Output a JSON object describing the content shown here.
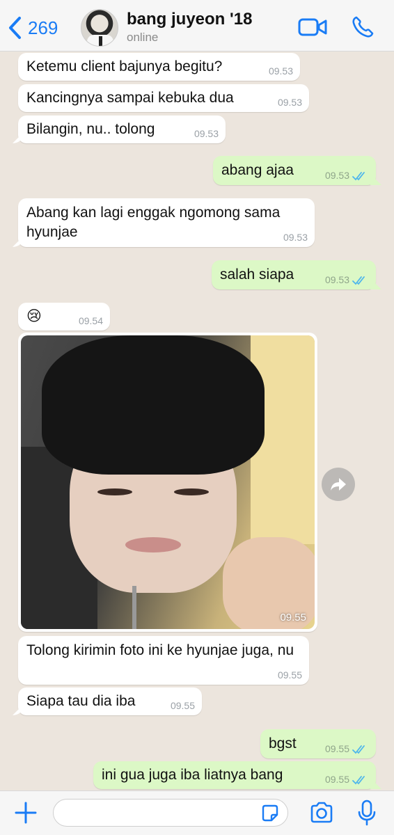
{
  "header": {
    "back_count": "269",
    "contact_name": "bang juyeon '18",
    "status": "online"
  },
  "messages": [
    {
      "dir": "in",
      "text": "Ketemu client bajunya begitu?",
      "time": "09.53"
    },
    {
      "dir": "in",
      "text": "Kancingnya sampai kebuka dua",
      "time": "09.53"
    },
    {
      "dir": "in",
      "text": "Bilangin, nu.. tolong",
      "time": "09.53"
    },
    {
      "dir": "out",
      "text": "abang ajaa",
      "time": "09.53"
    },
    {
      "dir": "in",
      "text": "Abang kan lagi enggak ngomong sama hyunjae",
      "time": "09.53"
    },
    {
      "dir": "out",
      "text": "salah siapa",
      "time": "09.53"
    },
    {
      "dir": "in",
      "text": "😢",
      "time": "09.54"
    },
    {
      "dir": "in",
      "type": "photo",
      "time": "09.55"
    },
    {
      "dir": "in",
      "text": "Tolong kirimin foto ini ke hyunjae juga, nu",
      "time": "09.55"
    },
    {
      "dir": "in",
      "text": "Siapa tau dia iba",
      "time": "09.55"
    },
    {
      "dir": "out",
      "text": "bgst",
      "time": "09.55"
    },
    {
      "dir": "out",
      "text": "ini gua juga iba liatnya bang",
      "time": "09.55"
    }
  ],
  "input": {
    "value": ""
  },
  "colors": {
    "accent": "#1a7cf5",
    "outgoing": "#dcf8c6",
    "incoming": "#ffffff",
    "background": "#ece5dd",
    "read_ticks": "#4fb6ec"
  },
  "icons": [
    "chevron-left-icon",
    "video-camera-icon",
    "phone-icon",
    "forward-icon",
    "plus-icon",
    "sticker-icon",
    "camera-icon",
    "microphone-icon",
    "double-check-icon"
  ]
}
